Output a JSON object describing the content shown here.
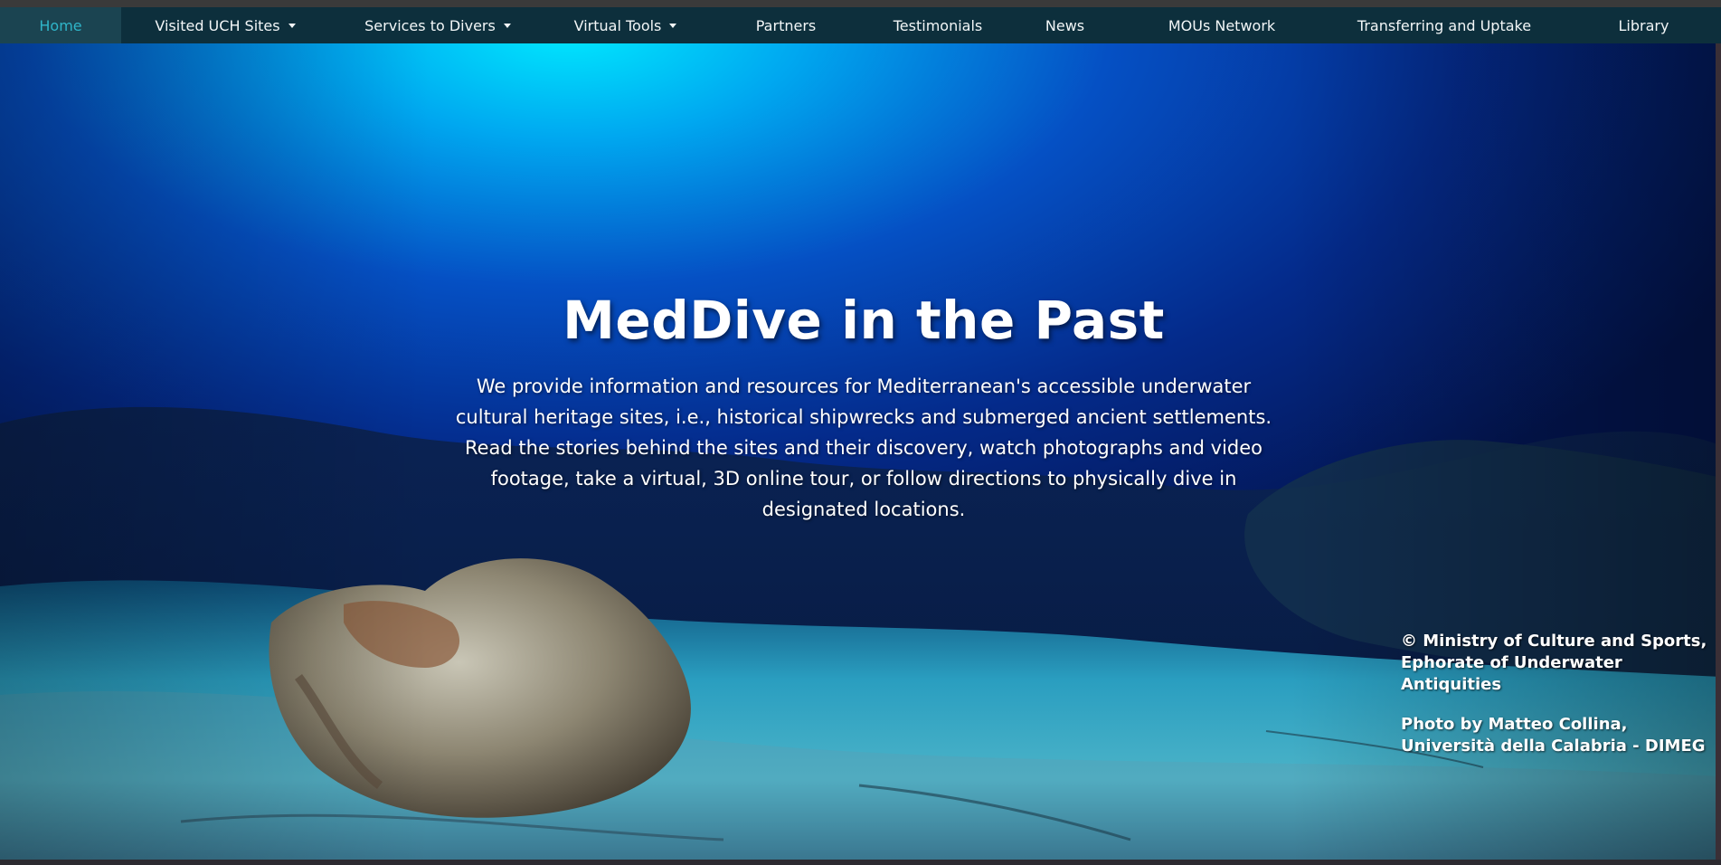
{
  "nav": {
    "items": [
      {
        "label": "Home",
        "active": true,
        "dropdown": false
      },
      {
        "label": "Visited UCH Sites",
        "active": false,
        "dropdown": true
      },
      {
        "label": "Services to Divers",
        "active": false,
        "dropdown": true
      },
      {
        "label": "Virtual Tools",
        "active": false,
        "dropdown": true
      },
      {
        "label": "Partners",
        "active": false,
        "dropdown": false
      },
      {
        "label": "Testimonials",
        "active": false,
        "dropdown": false
      },
      {
        "label": "News",
        "active": false,
        "dropdown": false
      },
      {
        "label": "MOUs Network",
        "active": false,
        "dropdown": false
      },
      {
        "label": "Transferring and Uptake",
        "active": false,
        "dropdown": false
      },
      {
        "label": "Library",
        "active": false,
        "dropdown": false
      }
    ]
  },
  "hero": {
    "title": "MedDive in the Past",
    "description": "We provide information and resources for Mediterranean's accessible underwater cultural heritage sites, i.e., historical shipwrecks and submerged ancient settlements. Read the stories behind the sites and their discovery, watch photographs and video footage, take a virtual, 3D online tour, or follow directions to physically dive in designated locations.",
    "credit": {
      "line1": "© Ministry of Culture and Sports,",
      "line2": "Ephorate of Underwater Antiquities",
      "line3": "Photo by Matteo Collina,",
      "line4": "Università della Calabria - DIMEG"
    }
  },
  "colors": {
    "navbar": "#0d2f3c",
    "active_nav_bg": "#1b4451",
    "active_nav_text": "#2fb5c9",
    "water_top": "#00e1ff",
    "water_deep": "#03155a"
  }
}
